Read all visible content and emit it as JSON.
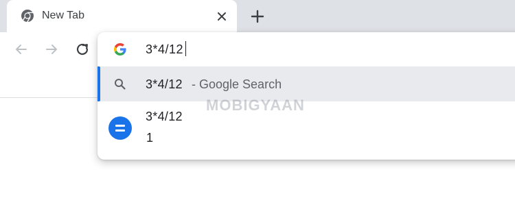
{
  "tabs": [
    {
      "title": "New Tab",
      "favicon": "chrome-icon"
    }
  ],
  "omnibox": {
    "input_value": "3*4/12",
    "suggestions": [
      {
        "query": "3*4/12",
        "separator": "-",
        "description": "Google Search",
        "icon": "search-icon",
        "selected": true
      },
      {
        "expression": "3*4/12",
        "result": "1",
        "icon": "calculator-icon"
      }
    ]
  },
  "watermark_text": "MOBIGYAAN",
  "colors": {
    "tabstrip_bg": "#dee1e6",
    "selected_row_bg": "#e8eaed",
    "accent_blue": "#1a73e8",
    "text_primary": "#202124",
    "text_secondary": "#5f6368"
  }
}
